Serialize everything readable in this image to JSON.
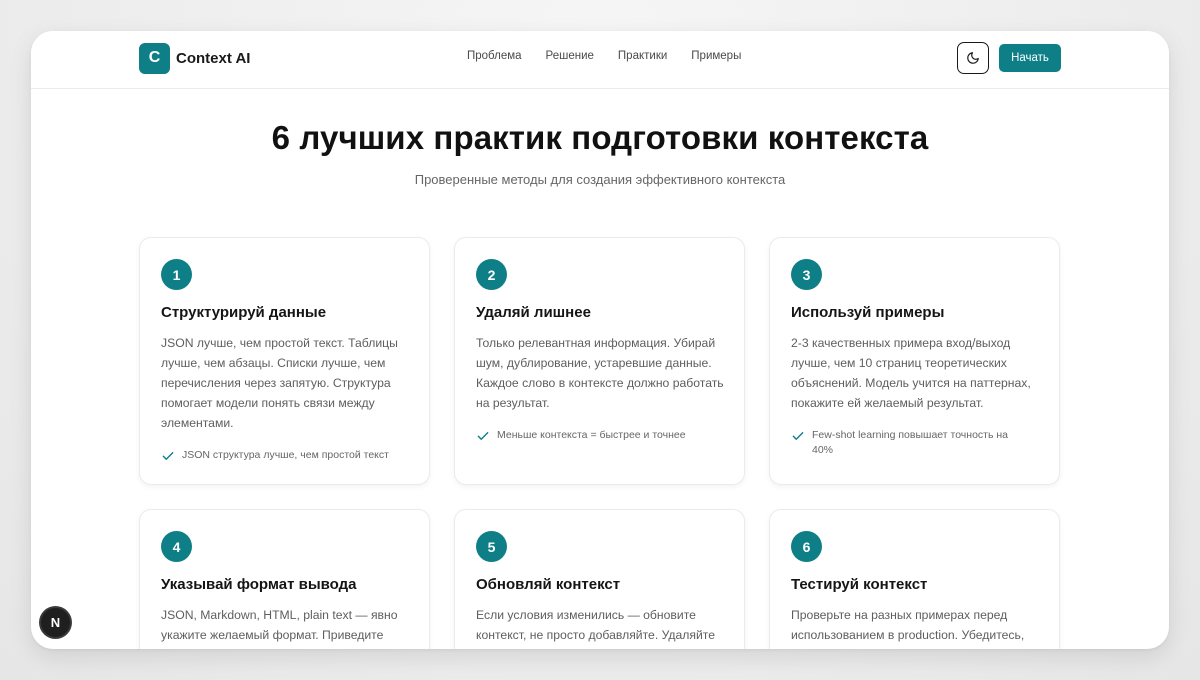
{
  "header": {
    "logo_letter": "C",
    "brand": "Context AI",
    "nav": [
      "Проблема",
      "Решение",
      "Практики",
      "Примеры"
    ],
    "theme_icon": "moon-icon",
    "start_label": "Начать"
  },
  "hero": {
    "title": "6 лучших практик подготовки контекста",
    "subtitle": "Проверенные методы для создания эффективного контекста"
  },
  "cards": [
    {
      "number": "1",
      "title": "Структурируй данные",
      "description": "JSON лучше, чем простой текст. Таблицы лучше, чем абзацы. Списки лучше, чем перечисления через запятую. Структура помогает модели понять связи между элементами.",
      "tip": "JSON структура лучше, чем простой текст"
    },
    {
      "number": "2",
      "title": "Удаляй лишнее",
      "description": "Только релевантная информация. Убирай шум, дублирование, устаревшие данные. Каждое слово в контексте должно работать на результат.",
      "tip": "Меньше контекста = быстрее и точнее"
    },
    {
      "number": "3",
      "title": "Используй примеры",
      "description": "2-3 качественных примера вход/выход лучше, чем 10 страниц теоретических объяснений. Модель учится на паттернах, покажите ей желаемый результат.",
      "tip": "Few-shot learning повышает точность на 40%"
    },
    {
      "number": "4",
      "title": "Указывай формат вывода",
      "description": "JSON, Markdown, HTML, plain text — явно укажите желаемый формат. Приведите"
    },
    {
      "number": "5",
      "title": "Обновляй контекст",
      "description": "Если условия изменились — обновите контекст, не просто добавляйте. Удаляйте"
    },
    {
      "number": "6",
      "title": "Тестируй контекст",
      "description": "Проверьте на разных примерах перед использованием в production. Убедитесь,"
    }
  ],
  "fab": {
    "letter": "N"
  },
  "colors": {
    "accent": "#0e7f86",
    "text": "#151515",
    "muted": "#5e5e5e"
  }
}
